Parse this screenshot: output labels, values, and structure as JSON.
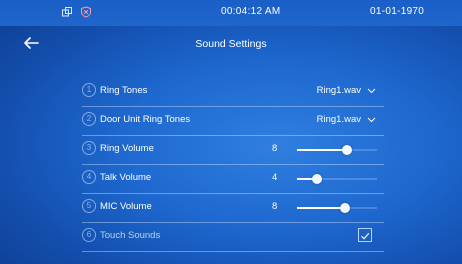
{
  "status": {
    "time": "00:04:12  AM",
    "date": "01-01-1970"
  },
  "header": {
    "title": "Sound Settings"
  },
  "settings": [
    {
      "index": "1",
      "label": "Ring Tones",
      "value": "Ring1.wav"
    },
    {
      "index": "2",
      "label": "Door Unit Ring Tones",
      "value": "Ring1.wav"
    },
    {
      "index": "3",
      "label": "Ring Volume",
      "value": "8",
      "level": 0.62
    },
    {
      "index": "4",
      "label": "Talk Volume",
      "value": "4",
      "level": 0.25
    },
    {
      "index": "5",
      "label": "MIC Volume",
      "value": "8",
      "level": 0.6
    },
    {
      "index": "6",
      "label": "Touch Sounds",
      "checked": true
    }
  ],
  "icons": {
    "back": "back-arrow-icon",
    "dropdown": "chevron-down-icon",
    "check": "check-icon"
  }
}
